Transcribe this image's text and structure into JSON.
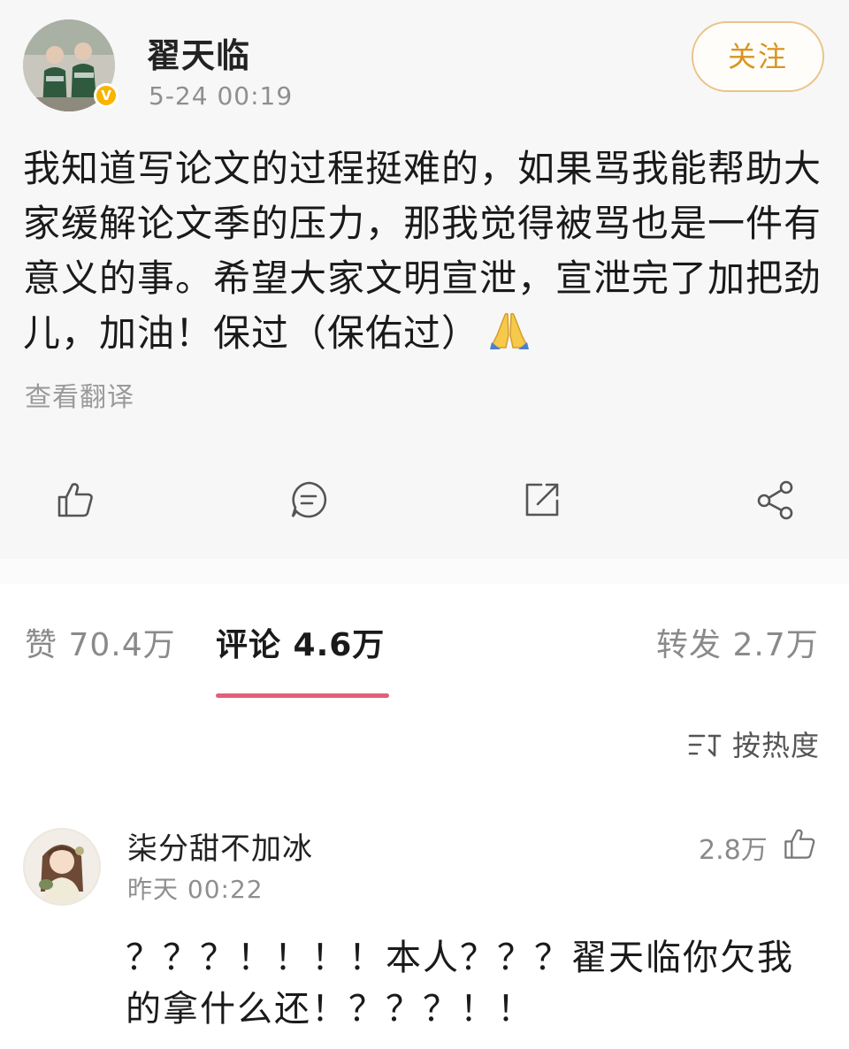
{
  "post": {
    "author": "翟天临",
    "timestamp": "5-24 00:19",
    "follow_label": "关注",
    "verified_badge": "V",
    "text": "我知道写论文的过程挺难的，如果骂我能帮助大家缓解论文季的压力，那我觉得被骂也是一件有意义的事。希望大家文明宣泄，宣泄完了加把劲儿，加油！保过（保佑过）",
    "emoji": "🙏",
    "translate_label": "查看翻译",
    "actions": [
      "like-icon",
      "comment-icon",
      "repost-icon",
      "share-icon"
    ]
  },
  "stats": {
    "likes": "赞 70.4万",
    "comments": "评论 4.6万",
    "reposts": "转发 2.7万",
    "active_tab": "comments"
  },
  "sort": {
    "label": "按热度",
    "icon": "sort-icon"
  },
  "comment": {
    "author": "柒分甜不加冰",
    "time": "昨天 00:22",
    "likes": "2.8万",
    "text": "？？？！！！！本人？？？翟天临你欠我的拿什么还！？？？！！"
  },
  "colors": {
    "accent_tab": "#e25f7a",
    "follow_text": "#d9941f",
    "follow_border": "#e9c48a",
    "verified": "#f7b500"
  }
}
